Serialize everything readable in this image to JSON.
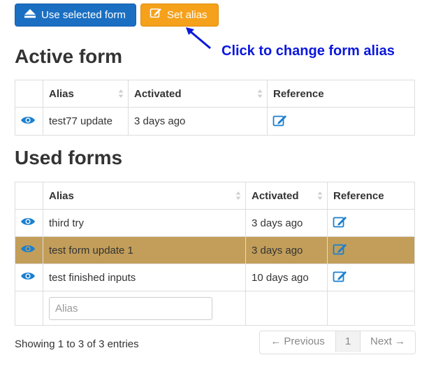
{
  "toolbar": {
    "use_selected_label": "Use selected form",
    "set_alias_label": "Set alias"
  },
  "annotation": "Click to change form alias",
  "active_form": {
    "heading": "Active form",
    "columns": [
      "Alias",
      "Activated",
      "Reference"
    ],
    "rows": [
      {
        "alias": "test77 update",
        "activated": "3 days ago"
      }
    ]
  },
  "used_forms": {
    "heading": "Used forms",
    "columns": [
      "Alias",
      "Activated",
      "Reference"
    ],
    "rows": [
      {
        "alias": "third try",
        "activated": "3 days ago"
      },
      {
        "alias": "test form update 1",
        "activated": "3 days ago"
      },
      {
        "alias": "test finished inputs",
        "activated": "10 days ago"
      }
    ],
    "filter_placeholder": "Alias"
  },
  "info_text": "Showing 1 to 3 of 3 entries",
  "pagination": {
    "previous": "← Previous",
    "page": "1",
    "next": "Next →"
  },
  "colors": {
    "primary": "#1a6fc2",
    "warning": "#f5a11b",
    "annotation": "#0a17dc",
    "highlight_row": "#c29e5a",
    "icon": "#1a7fd0"
  },
  "icons": [
    "eject-icon",
    "edit-icon",
    "eye-icon",
    "sort-icon",
    "arrow-icon"
  ]
}
